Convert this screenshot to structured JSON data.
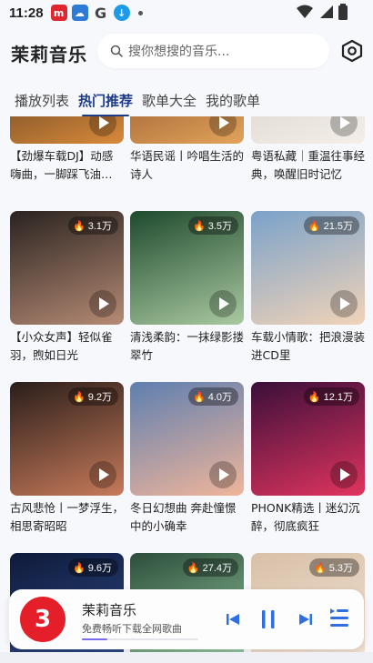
{
  "status": {
    "time": "11:28",
    "icons": [
      "app-m-icon",
      "cloud-icon",
      "google-g-icon",
      "download-icon",
      "dot-icon",
      "wifi-icon",
      "signal-icon",
      "battery-icon"
    ]
  },
  "header": {
    "title": "茉莉音乐",
    "search_placeholder": "搜你想搜的音乐..."
  },
  "tabs": [
    {
      "label": "播放列表",
      "active": false
    },
    {
      "label": "热门推荐",
      "active": true
    },
    {
      "label": "歌单大全",
      "active": false
    },
    {
      "label": "我的歌单",
      "active": false
    }
  ],
  "playlists": [
    {
      "title": "【劲爆车载DJ】动感嗨曲，一脚踩飞油…",
      "count": "",
      "colors": [
        "#3b2a1c",
        "#d98a3a"
      ]
    },
    {
      "title": "华语民谣丨吟唱生活的诗人",
      "count": "",
      "colors": [
        "#7a3b1f",
        "#e2a45a"
      ]
    },
    {
      "title": "粤语私藏｜重温往事经典，唤醒旧时记忆",
      "count": "",
      "colors": [
        "#cfc9c2",
        "#f4efe9"
      ]
    },
    {
      "title": "【小众女声】轻似雀羽，煦如日光",
      "count": "3.1万",
      "colors": [
        "#2a2320",
        "#b58a74"
      ]
    },
    {
      "title": "清浅柔韵：一抹绿影搂翠竹",
      "count": "3.5万",
      "colors": [
        "#1f4a2e",
        "#a9c9a0"
      ]
    },
    {
      "title": "车载小情歌：把浪漫装进CD里",
      "count": "21.5万",
      "colors": [
        "#7aa2c9",
        "#f1d3b8"
      ]
    },
    {
      "title": "古风悲怆丨一梦浮生，相思寄昭昭",
      "count": "9.2万",
      "colors": [
        "#2a1e1a",
        "#c77a5a"
      ]
    },
    {
      "title": "冬日幻想曲 奔赴憧憬中的小确幸",
      "count": "4.0万",
      "colors": [
        "#5e7fb0",
        "#f0b59a"
      ]
    },
    {
      "title": "PHONK精选丨迷幻沉醉，彻底疯狂",
      "count": "12.1万",
      "colors": [
        "#3a0f3a",
        "#e0345e"
      ]
    },
    {
      "title": "",
      "count": "9.6万",
      "colors": [
        "#0f1a3a",
        "#2f4c8a"
      ]
    },
    {
      "title": "",
      "count": "27.4万",
      "colors": [
        "#2c4d3a",
        "#9ad0a6"
      ]
    },
    {
      "title": "",
      "count": "5.3万",
      "colors": [
        "#d8c0a8",
        "#f3e4d6"
      ]
    }
  ],
  "player": {
    "logo_text": "3",
    "title": "茉莉音乐",
    "subtitle": "免费畅听下载全网歌曲",
    "progress": 0.22,
    "accent": "#2f6fe0"
  },
  "colors": {
    "tab_active": "#1d3c8a",
    "progress": "#7a6cf0"
  }
}
